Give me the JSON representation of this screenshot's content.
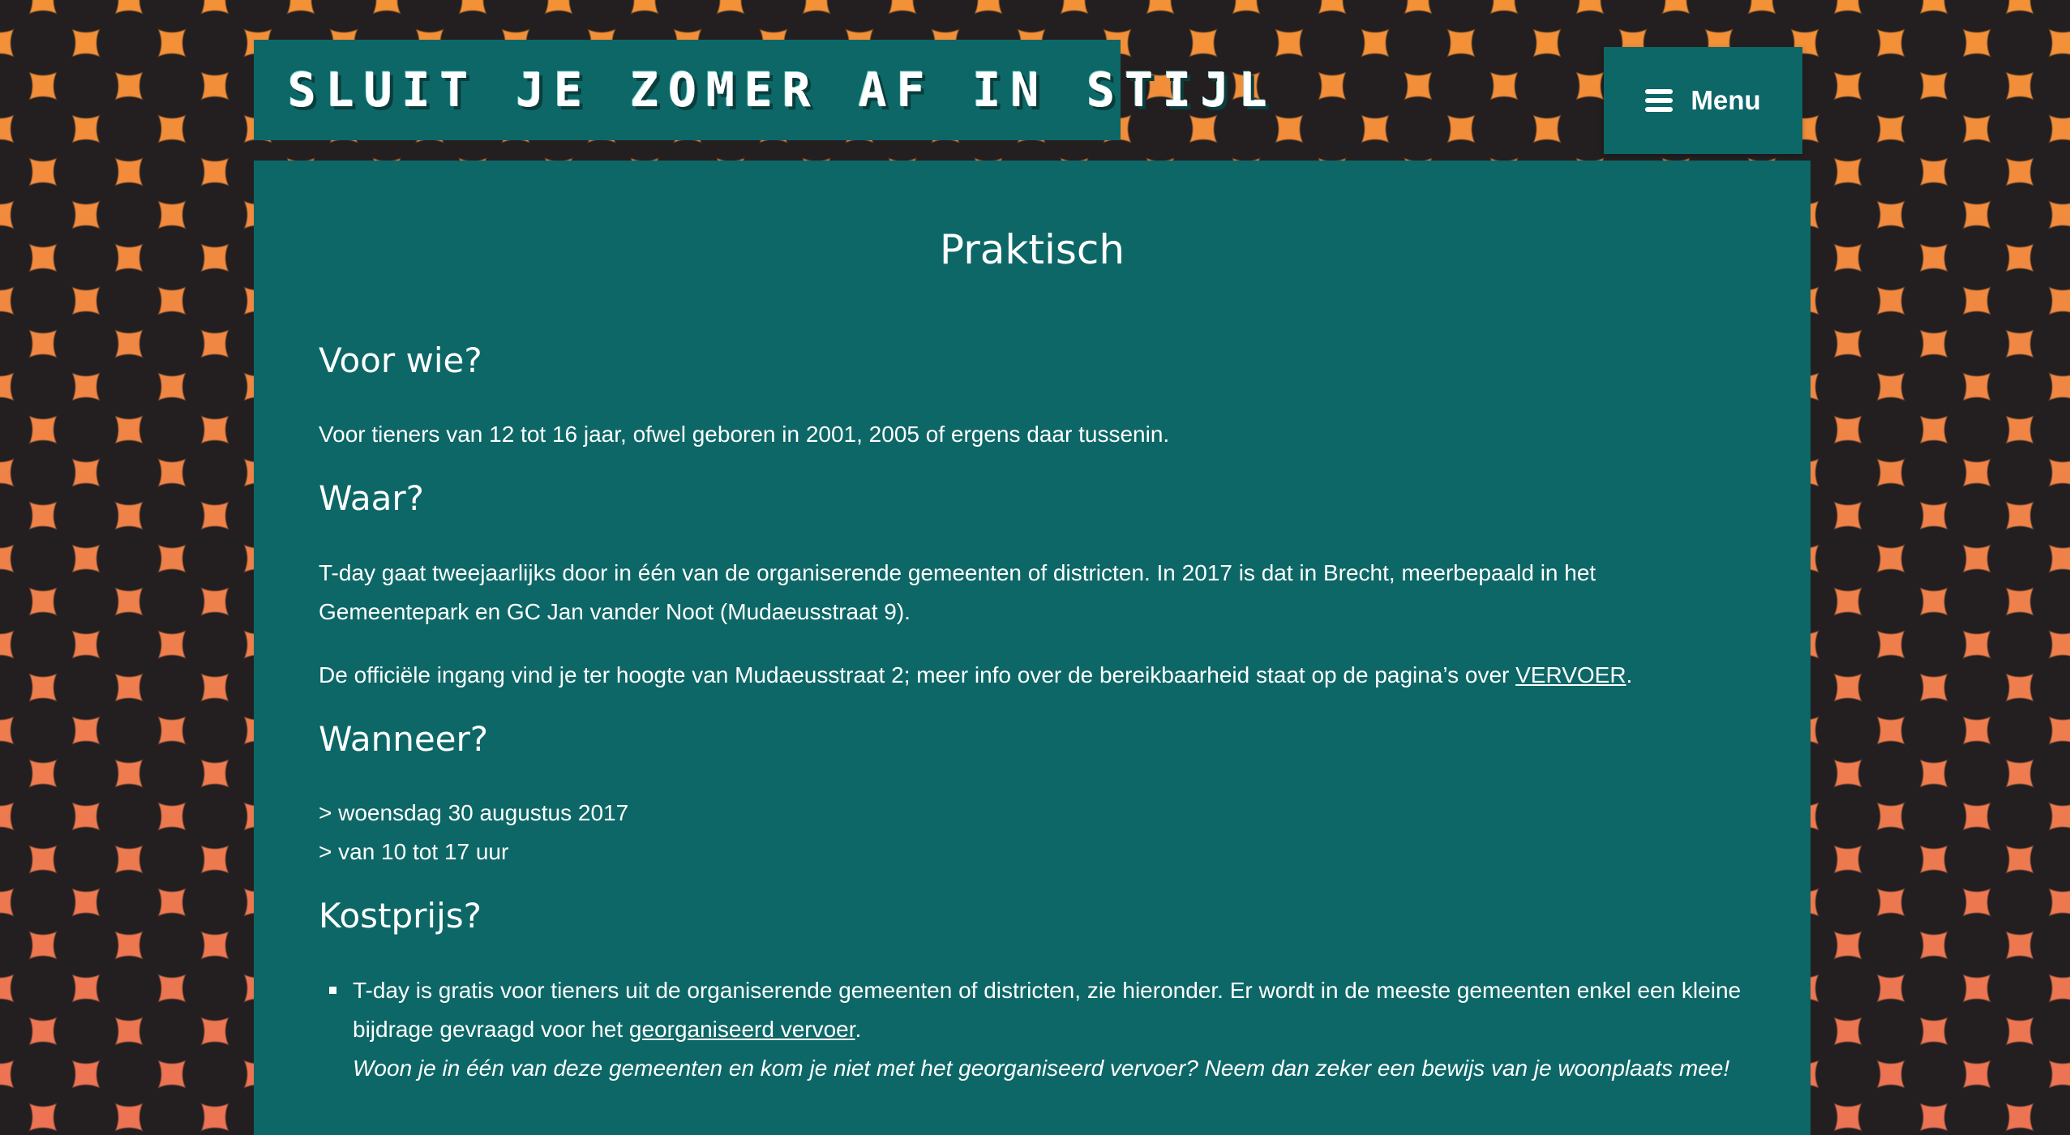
{
  "header": {
    "site_title": "Sluit je zomer af in stijl",
    "menu_label": "Menu"
  },
  "page": {
    "title": "Praktisch",
    "voor_wie": {
      "heading": "Voor wie?",
      "text": "Voor tieners van 12 tot 16 jaar, ofwel geboren in 2001, 2005 of ergens daar tussenin."
    },
    "waar": {
      "heading": "Waar?",
      "text1": "T-day gaat tweejaarlijks door in één van de organiserende gemeenten of districten. In 2017 is dat in Brecht, meerbepaald in het Gemeentepark en GC Jan vander Noot (Mudaeusstraat 9).",
      "text2_before": "De officiële ingang vind je ter hoogte van Mudaeusstraat 2; meer info over de bereikbaarheid staat op de pagina’s over ",
      "text2_link": "VERVOER",
      "text2_after": "."
    },
    "wanneer": {
      "heading": "Wanneer?",
      "line1": "> woensdag 30 augustus 2017",
      "line2": "> van 10 tot 17 uur"
    },
    "kostprijs": {
      "heading": "Kostprijs?",
      "item_before": "T-day is gratis voor tieners uit de organiserende gemeenten of districten, zie hieronder. Er wordt in de meeste gemeenten enkel een kleine bijdrage gevraagd voor het ",
      "item_link": "georganiseerd vervoer",
      "item_after": ".",
      "item_italic": "Woon je in één van deze gemeenten en kom je niet met het georganiseerd vervoer? Neem dan zeker een bewijs van je woonplaats mee!"
    }
  },
  "colors": {
    "teal": "#0d6767",
    "orange": "#f39136",
    "dots": "#231f20"
  },
  "icons": {
    "menu": "hamburger-icon"
  }
}
